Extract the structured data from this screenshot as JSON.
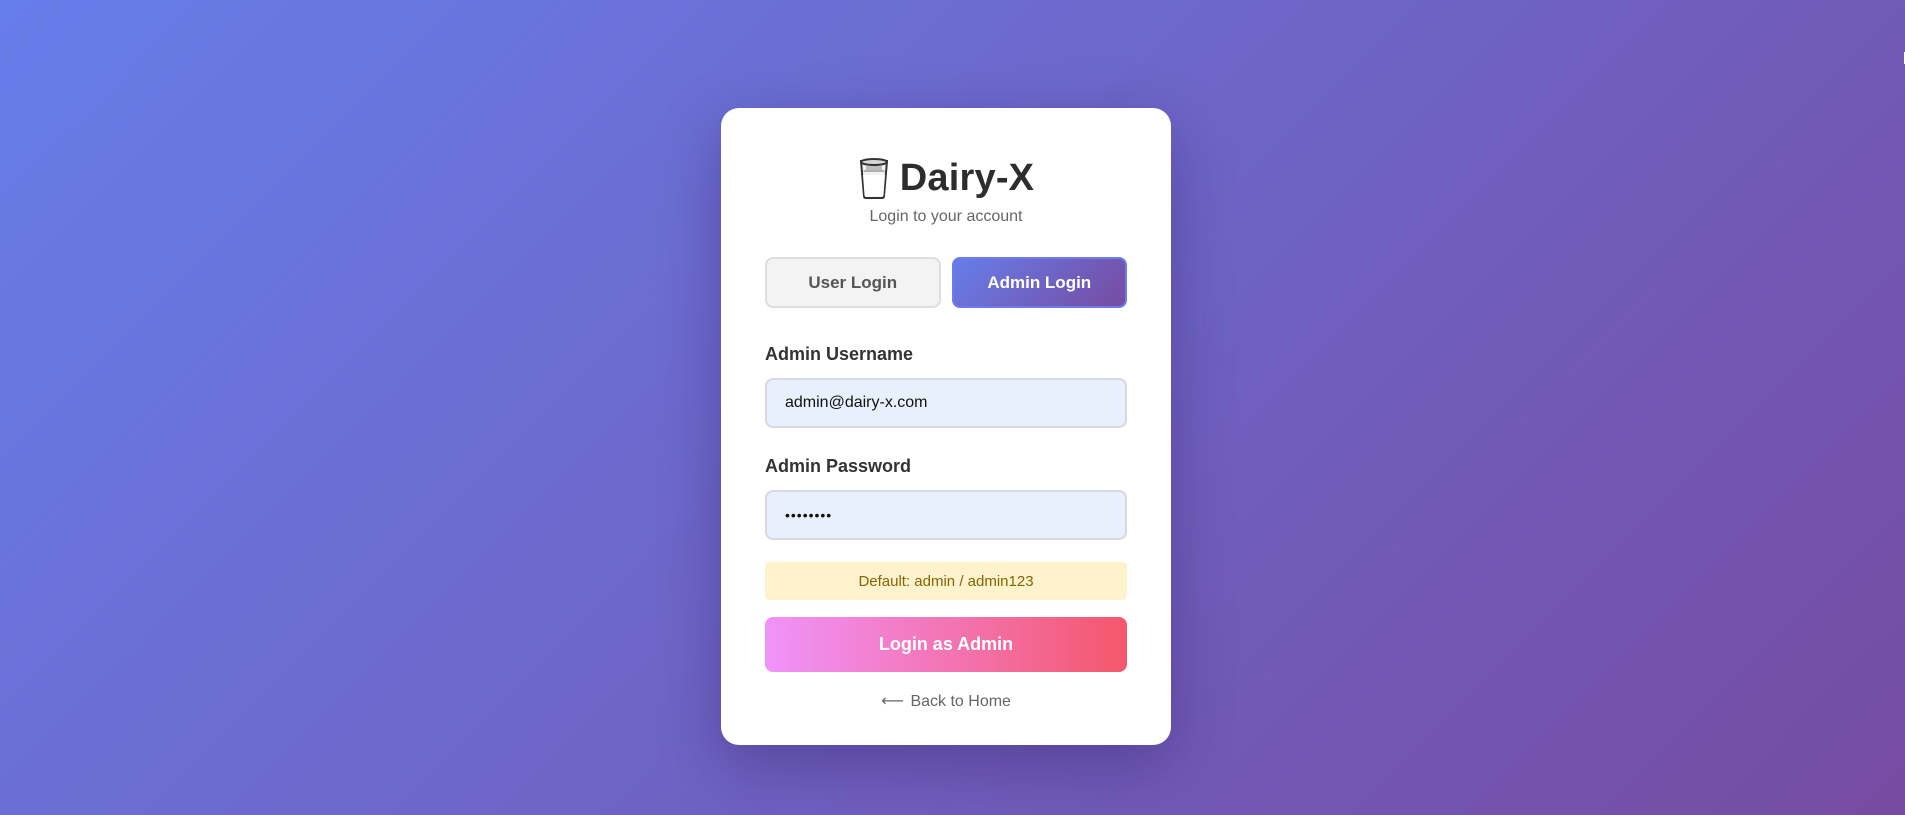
{
  "brand": {
    "icon": "milk-glass-icon",
    "title": "Dairy-X",
    "subtitle": "Login to your account"
  },
  "tabs": [
    {
      "label": "User Login",
      "active": false
    },
    {
      "label": "Admin Login",
      "active": true
    }
  ],
  "form": {
    "username_label": "Admin Username",
    "username_value": "admin@dairy-x.com",
    "password_label": "Admin Password",
    "password_value": "••••••••",
    "hint": "Default: admin / admin123",
    "submit_label": "Login as Admin"
  },
  "back_link": {
    "arrow": "⟵",
    "label": "Back to Home"
  },
  "colors": {
    "background_start": "#667eea",
    "background_end": "#764ba2",
    "submit_start": "#f093fb",
    "submit_end": "#f5576c",
    "hint_bg": "#fff3cd",
    "hint_text": "#856404"
  }
}
